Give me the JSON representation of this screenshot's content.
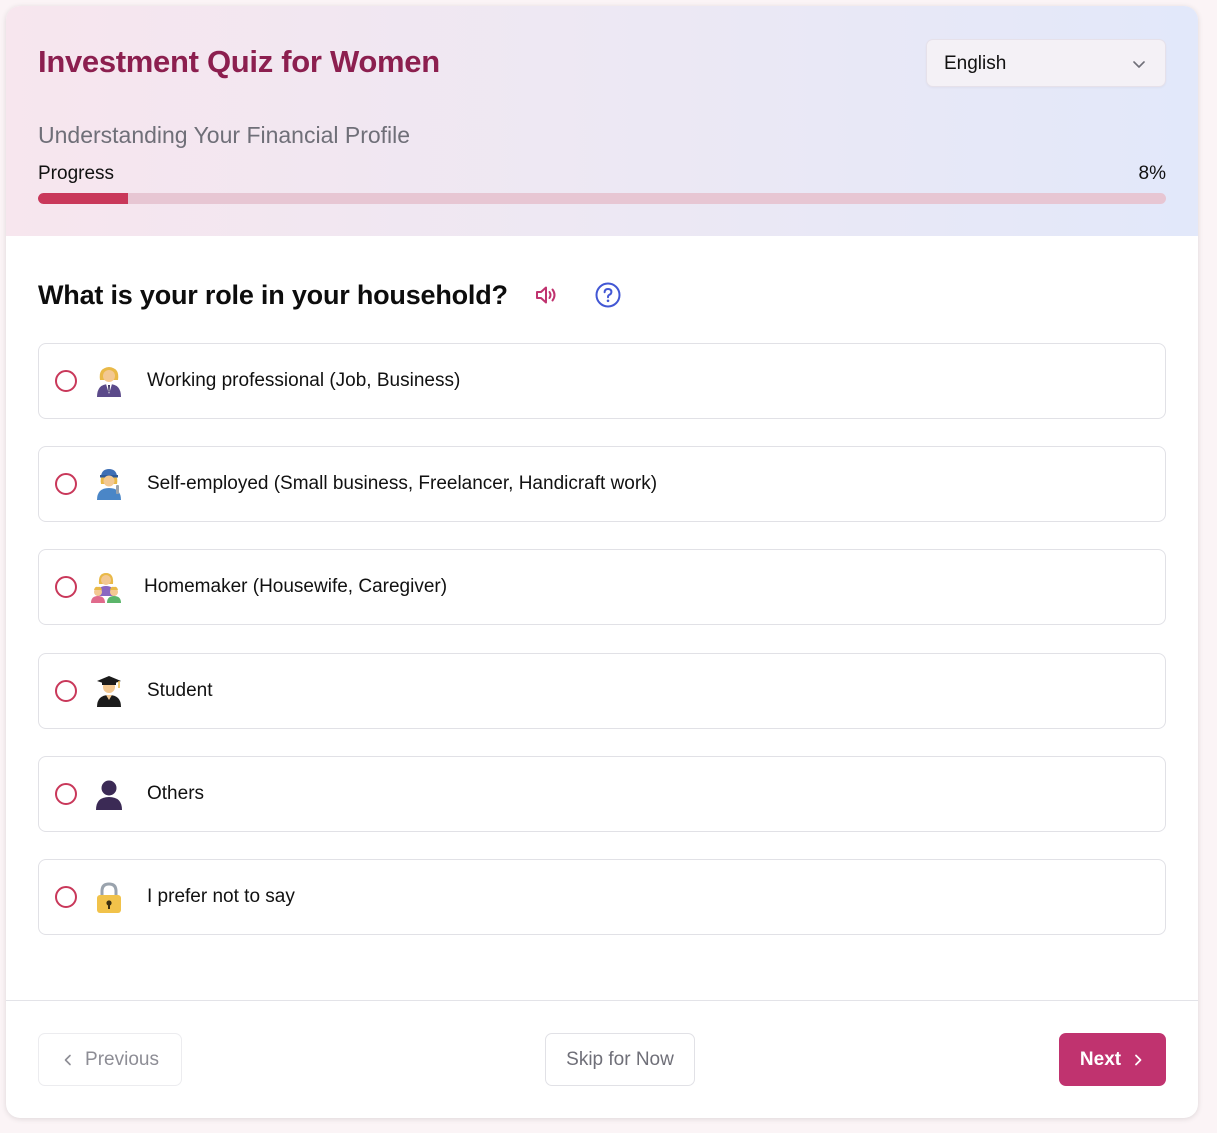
{
  "header": {
    "title": "Investment Quiz for Women",
    "language": {
      "selected": "English",
      "icon": "chevron-down-icon"
    },
    "subtitle": "Understanding Your Financial Profile",
    "progress": {
      "label": "Progress",
      "value_text": "8%",
      "value": 8
    }
  },
  "question": {
    "text": "What is your role in your household?",
    "speaker_icon": "speaker-icon",
    "help_icon": "help-icon",
    "options": [
      {
        "label": "Working professional (Job, Business)",
        "icon": "woman-office-worker-icon"
      },
      {
        "label": "Self-employed (Small business, Freelancer, Handicraft work)",
        "icon": "woman-mechanic-icon"
      },
      {
        "label": "Homemaker (Housewife, Caregiver)",
        "icon": "family-icon"
      },
      {
        "label": "Student",
        "icon": "graduate-icon"
      },
      {
        "label": "Others",
        "icon": "person-silhouette-icon"
      },
      {
        "label": "I prefer not to say",
        "icon": "lock-icon"
      }
    ]
  },
  "footer": {
    "previous_label": "Previous",
    "skip_label": "Skip for Now",
    "next_label": "Next"
  },
  "colors": {
    "accent": "#c0336f",
    "title": "#8c1f4f",
    "radio": "#c9385a",
    "help": "#4257d4"
  }
}
